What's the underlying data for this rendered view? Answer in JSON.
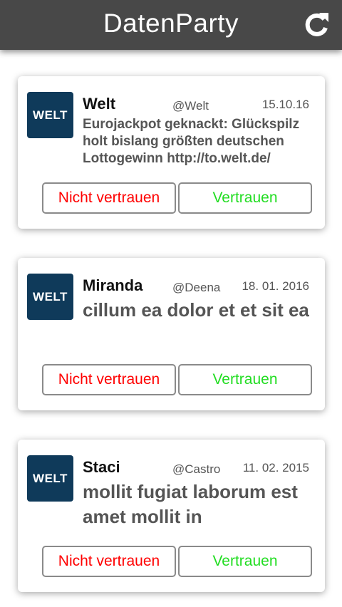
{
  "app": {
    "title": "DatenParty",
    "refresh_icon": "refresh-icon"
  },
  "buttons": {
    "distrust_label": "Nicht vertrauen",
    "trust_label": "Vertrauen"
  },
  "colors": {
    "appbar": "#484848",
    "logo_bg": "#0f3a5a",
    "distrust": "#ff0000",
    "trust": "#22dd22"
  },
  "cards": [
    {
      "logo_text": "WELT",
      "name": "Welt",
      "handle": "@Welt",
      "date": "15.10.16",
      "text": "Eurojackpot geknackt: Glückspilz holt bislang größten deutschen Lottogewinn http://to.welt.de/"
    },
    {
      "logo_text": "WELT",
      "name": "Miranda",
      "handle": "@Deena",
      "date": "18. 01. 2016",
      "text": "cillum ea dolor et et sit ea"
    },
    {
      "logo_text": "WELT",
      "name": "Staci",
      "handle": "@Castro",
      "date": "11. 02. 2015",
      "text": "mollit fugiat laborum est amet mollit in"
    }
  ]
}
